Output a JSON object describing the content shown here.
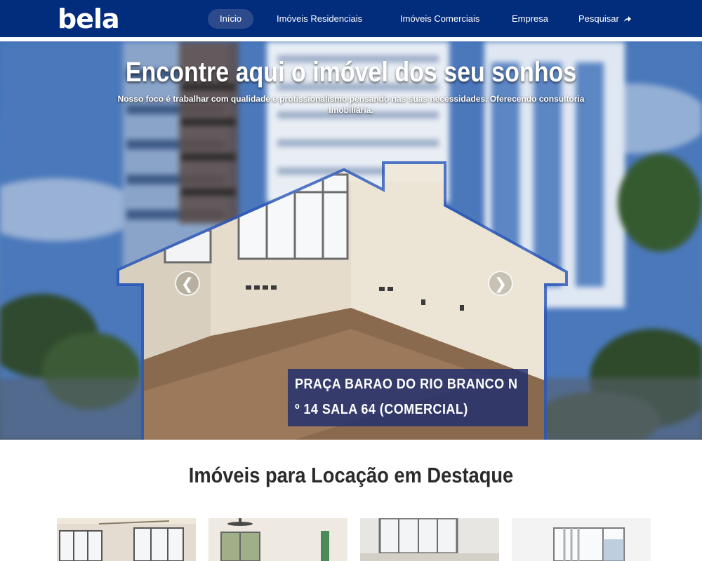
{
  "brand": {
    "logo_text": "bela"
  },
  "nav": {
    "items": [
      {
        "label": "Início",
        "active": true
      },
      {
        "label": "Imóveis Residenciais",
        "active": false
      },
      {
        "label": "Imóveis Comerciais",
        "active": false
      },
      {
        "label": "Empresa",
        "active": false
      },
      {
        "label": "Pesquisar",
        "active": false,
        "icon": "share-arrow-icon"
      }
    ]
  },
  "hero": {
    "title": "Encontre aqui o imóvel dos seu sonhos",
    "subtitle": "Nosso foco é trabalhar com qualidade e profissionalismo pensando nas suas necessidades. Oferecendo consultoria Imobiliária.",
    "prev_glyph": "❮",
    "next_glyph": "❯",
    "caption_line1": "PRAÇA BARAO DO RIO BRANCO N",
    "caption_line2": "º 14 SALA 64 (COMERCIAL)"
  },
  "featured": {
    "title": "Imóveis para Locação em Destaque",
    "cards": [
      "card-1",
      "card-2",
      "card-3",
      "card-4"
    ]
  },
  "colors": {
    "navbar": "#022c7c",
    "active_pill": "#2c4a8c",
    "caption_bg": "#1e2d6e",
    "title_text": "#2a2a2a"
  }
}
